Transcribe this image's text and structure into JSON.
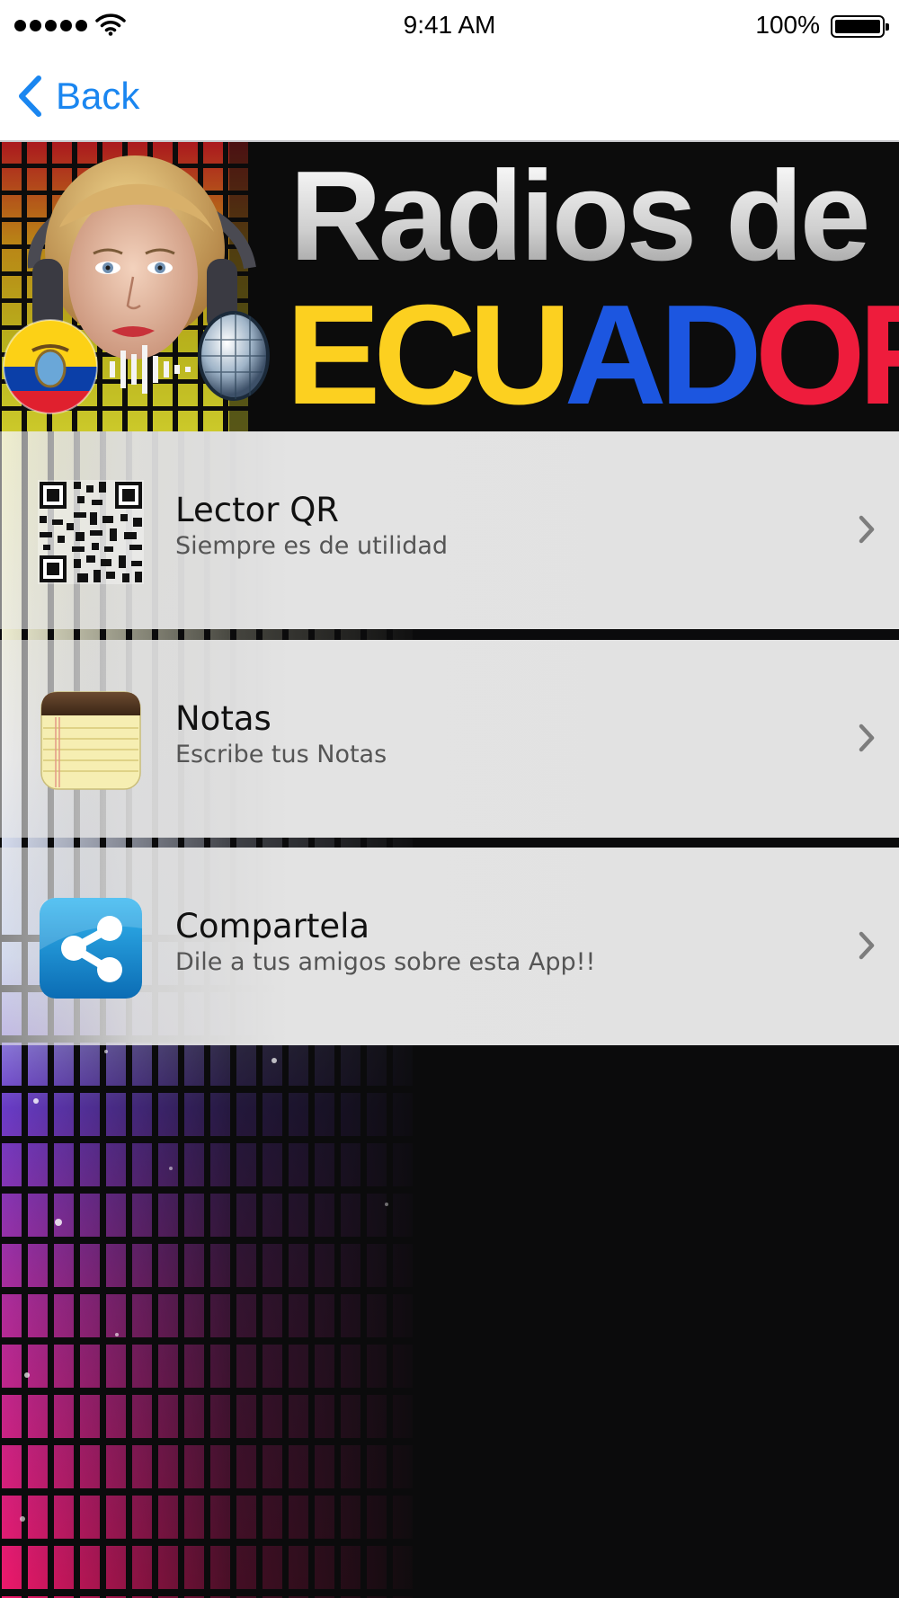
{
  "status_bar": {
    "time": "9:41 AM",
    "battery": "100%"
  },
  "nav": {
    "back_label": "Back"
  },
  "banner": {
    "line1": "Radios de",
    "line2_letters": [
      "E",
      "C",
      "U",
      "A",
      "D",
      "O",
      "R"
    ]
  },
  "menu": [
    {
      "title": "Lector QR",
      "subtitle": "Siempre es de utilidad",
      "icon": "qr-code-icon"
    },
    {
      "title": "Notas",
      "subtitle": "Escribe tus Notas",
      "icon": "notepad-icon"
    },
    {
      "title": "Compartela",
      "subtitle": "Dile a tus amigos sobre esta App!!",
      "icon": "share-icon"
    }
  ],
  "colors": {
    "accent": "#1a86f0",
    "flag_yellow": "#fcd020",
    "flag_blue": "#1c56e0",
    "flag_red": "#ee1c3c"
  }
}
